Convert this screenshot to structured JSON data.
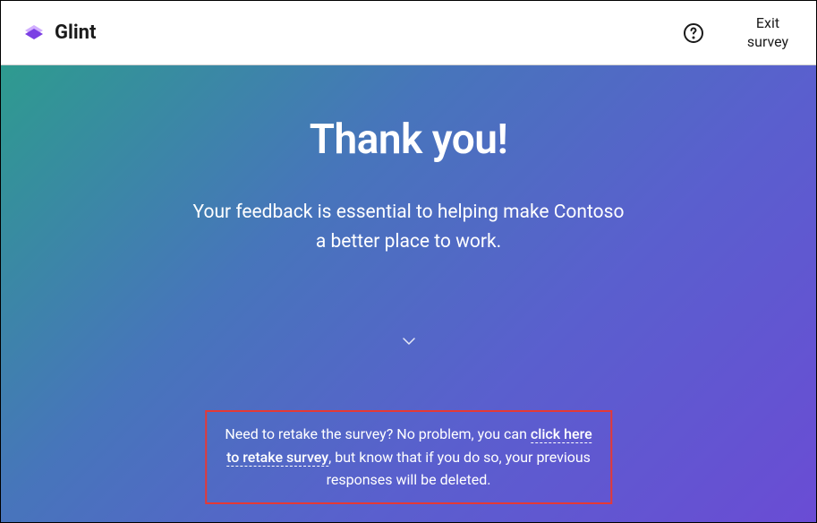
{
  "header": {
    "brand": "Glint",
    "exit_label": "Exit survey"
  },
  "main": {
    "title": "Thank you!",
    "message_line1": "Your feedback is essential to helping make Contoso",
    "message_line2": "a better place to work."
  },
  "retake": {
    "prefix": "Need to retake the survey? No problem, you can ",
    "link_text": "click here to retake survey",
    "suffix": ", but know that if you do so, your previous responses will be deleted."
  },
  "colors": {
    "highlight_border": "#e53935",
    "gradient_start": "#2e9b8f",
    "gradient_end": "#6a4cd4"
  }
}
